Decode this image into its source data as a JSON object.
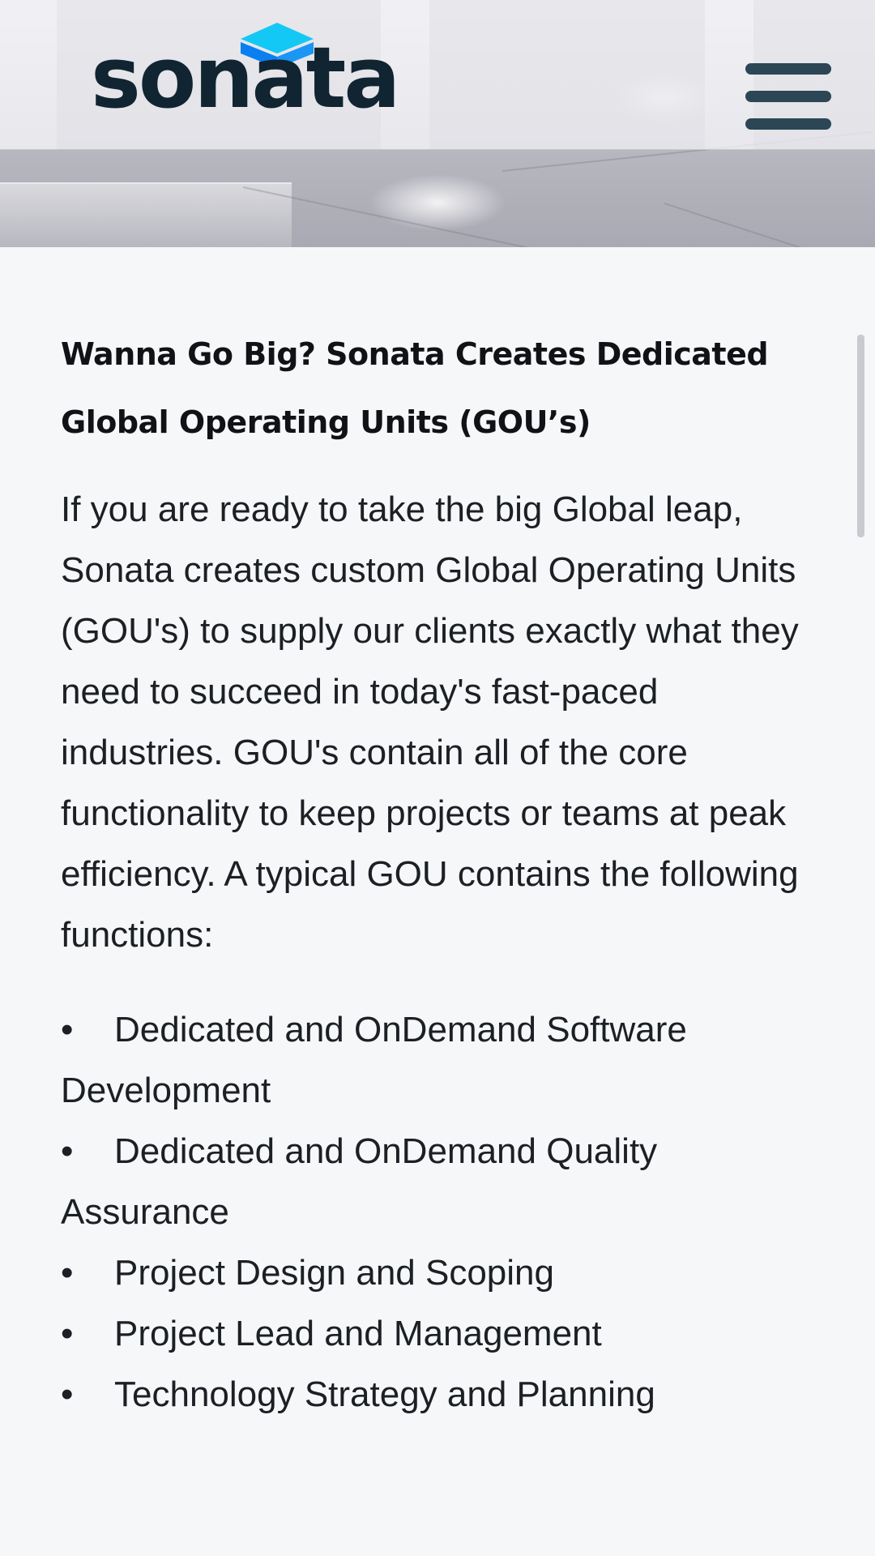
{
  "header": {
    "logo_text": "sonata",
    "logo_icon": "cube-logo-icon",
    "menu_icon": "hamburger-menu-icon"
  },
  "colors": {
    "logo_text": "#112431",
    "logo_accent": "#14c8f5",
    "menu": "#2c4655",
    "body_text": "#1c1f24",
    "page_background": "#f6f7f9"
  },
  "article": {
    "heading": "Wanna Go Big? Sonata Creates Dedicated Global Operating Units (GOU’s)",
    "paragraph": "If you are ready to take the big Global leap, Sonata creates custom Global Operating Units (GOU's) to supply our clients exactly what they need to succeed in today's fast-paced industries. GOU's contain all of the core functionality to keep projects or teams at peak efficiency. A typical GOU contains the following functions:",
    "functions": [
      "Dedicated and OnDemand Software Development",
      "Dedicated and OnDemand Quality Assurance",
      "Project Design and Scoping",
      "Project Lead and Management",
      "Technology Strategy and Planning"
    ]
  }
}
